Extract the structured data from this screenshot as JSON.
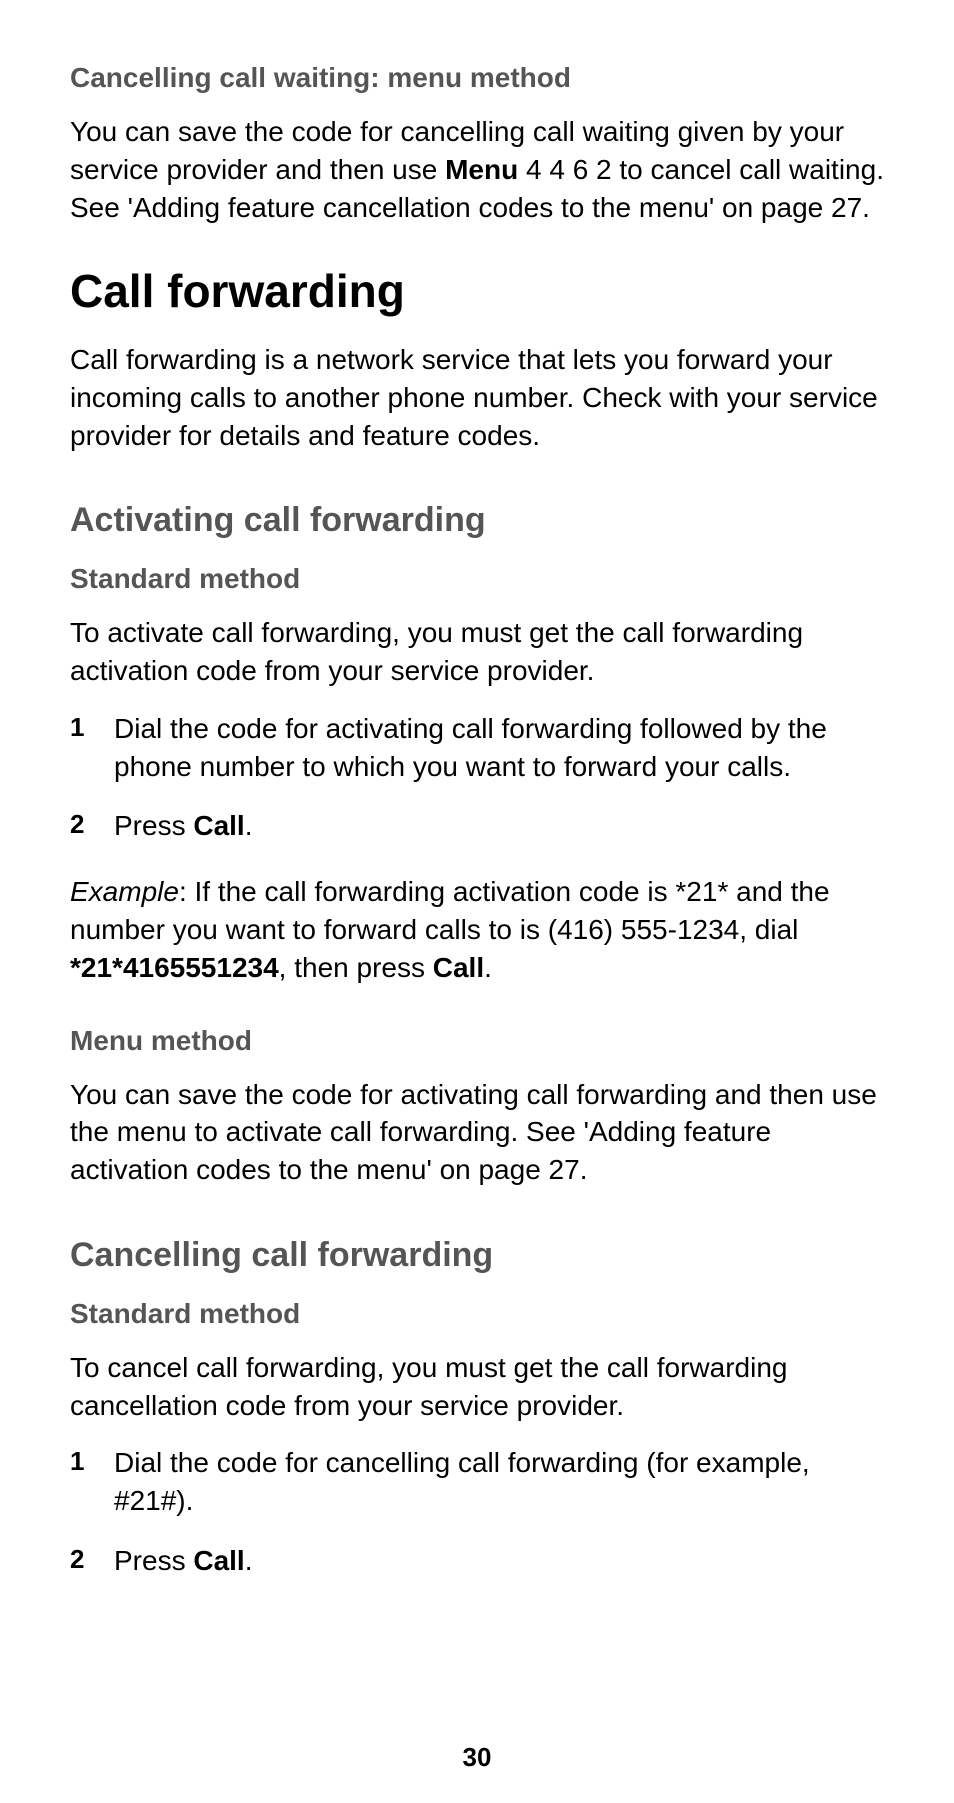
{
  "top": {
    "heading": "Cancelling call waiting: menu method",
    "para_pre": "You can save the code for cancelling call waiting given by your service provider and then use ",
    "para_bold": "Menu",
    "para_post": " 4 4 6 2 to cancel call waiting. See 'Adding feature cancellation codes to the menu' on page 27."
  },
  "cf": {
    "title": "Call forwarding",
    "intro": "Call forwarding is a network service that lets you forward your incoming calls to another phone number. Check with your service provider for details and feature codes."
  },
  "act": {
    "heading": "Activating call forwarding",
    "std": {
      "heading": "Standard method",
      "intro": "To activate call forwarding, you must get the call forwarding activation code from your service provider.",
      "step1": "Dial the code for activating call forwarding followed by the phone number to which you want to forward your calls.",
      "step2_pre": "Press ",
      "step2_bold": "Call",
      "step2_post": "."
    },
    "example": {
      "lead": "Example",
      "pre": ":  If the call forwarding activation code is *21* and the number you want to forward calls to is (416) 555-1234, dial ",
      "bold1": "*21*4165551234",
      "mid": ", then press ",
      "bold2": "Call",
      "post": "."
    },
    "menu": {
      "heading": "Menu method",
      "para": "You can save the code for activating call forwarding and then use the menu to activate call forwarding. See 'Adding feature activation codes to the menu' on page 27."
    }
  },
  "cancel": {
    "heading": "Cancelling call forwarding",
    "std": {
      "heading": "Standard method",
      "intro": "To cancel call forwarding, you must get the call forwarding cancellation code from your service provider.",
      "step1": "Dial the code for cancelling call forwarding (for example, #21#).",
      "step2_pre": "Press ",
      "step2_bold": "Call",
      "step2_post": "."
    }
  },
  "page_number": "30"
}
